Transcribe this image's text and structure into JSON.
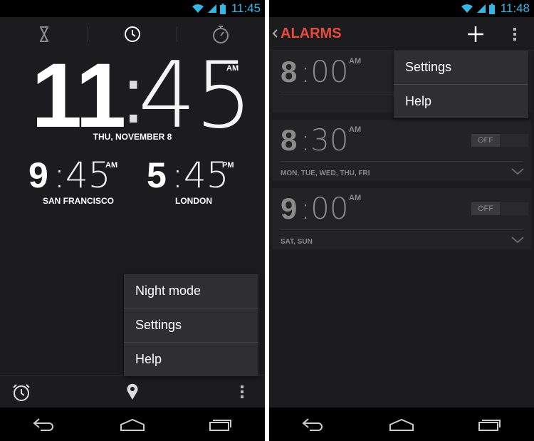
{
  "left": {
    "status_time": "11:45",
    "tabs": [
      {
        "icon": "hourglass-icon"
      },
      {
        "icon": "clock-icon"
      },
      {
        "icon": "stopwatch-icon"
      }
    ],
    "main_clock": {
      "hour": "11",
      "minute": "45",
      "ampm": "AM"
    },
    "date": "THU, NOVEMBER 8",
    "world_clocks": [
      {
        "hour": "9",
        "minute": "45",
        "ampm": "AM",
        "city": "SAN FRANCISCO"
      },
      {
        "hour": "5",
        "minute": "45",
        "ampm": "PM",
        "city": "LONDON"
      }
    ],
    "menu": [
      "Night mode",
      "Settings",
      "Help"
    ],
    "bottom_icons": [
      "alarm-clock-icon",
      "location-pin-icon",
      "overflow-menu-icon"
    ]
  },
  "right": {
    "status_time": "11:48",
    "title": "ALARMS",
    "menu": [
      "Settings",
      "Help"
    ],
    "alarms": [
      {
        "hour": "8",
        "minute": "00",
        "ampm": "AM",
        "days": ""
      },
      {
        "hour": "8",
        "minute": "30",
        "ampm": "AM",
        "days": "MON, TUE, WED, THU, FRI",
        "toggle": "OFF"
      },
      {
        "hour": "9",
        "minute": "00",
        "ampm": "AM",
        "days": "SAT, SUN",
        "toggle": "OFF"
      }
    ]
  },
  "nav_icons": [
    "back-icon",
    "home-icon",
    "recent-apps-icon"
  ],
  "colors": {
    "accent_blue": "#33b5e5",
    "accent_red": "#e84a3c",
    "background": "#1c1c1e"
  }
}
